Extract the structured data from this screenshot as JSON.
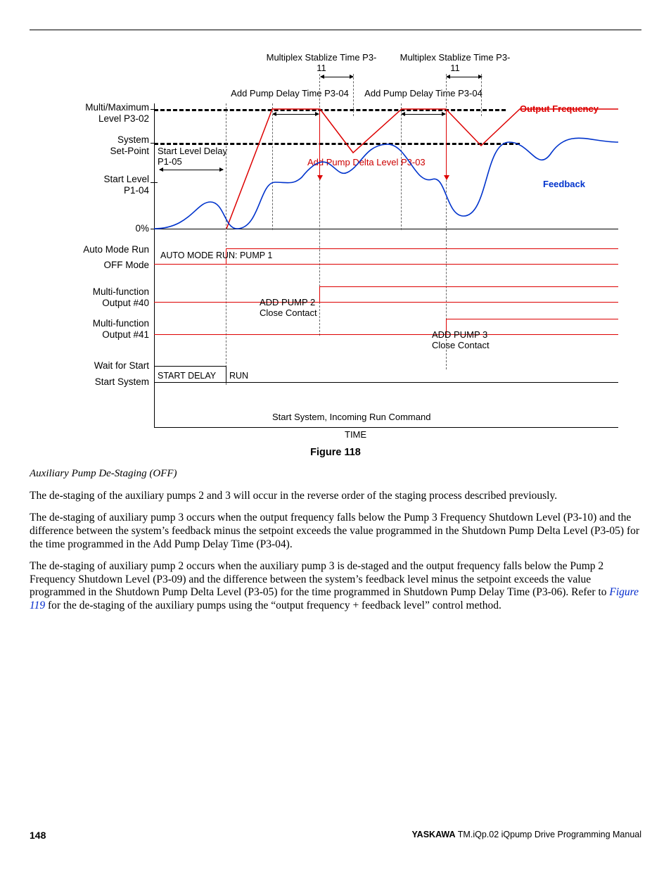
{
  "page_number": "148",
  "footer": {
    "brand": "YASKAWA",
    "pub": "TM.iQp.02 iQpump Drive Programming Manual"
  },
  "figure": {
    "caption": "Figure 118",
    "xaxis": "TIME",
    "start_cmd": "Start System, Incoming Run Command",
    "ylabels": {
      "mm": "Multi/Maximum\nLevel P3-02",
      "sp": "System\nSet-Point",
      "sl": "Start Level\nP1-04",
      "zero": "0%",
      "amr": "Auto Mode Run",
      "off": "OFF Mode",
      "mf40": "Multi-function\nOutput #40",
      "mf41": "Multi-function\nOutput #41",
      "wfs": "Wait for Start",
      "ss": "Start System"
    },
    "labels": {
      "mst": "Multiplex Stablize Time\nP3-11",
      "apdt": "Add Pump Delay Time\nP3-04",
      "apdl": "Add Pump Delta Level P3-03",
      "outf": "Output Frequency",
      "fb": "Feedback",
      "sld": "Start Level Delay\nP1-05",
      "amrp1": "AUTO MODE RUN: PUMP 1",
      "ap2": "ADD PUMP 2\nClose Contact",
      "ap3": "ADD PUMP 3\nClose Contact",
      "sd": "START DELAY",
      "run": "RUN"
    }
  },
  "text": {
    "subheading": "Auxiliary Pump De-Staging (OFF)",
    "p1": "The de-staging of the auxiliary pumps 2 and 3 will occur in the reverse order of the staging process described previously.",
    "p2": "The de-staging of auxiliary pump 3 occurs when the output frequency falls below the Pump 3 Frequency Shutdown Level (P3-10) and the difference between the system’s feedback minus the setpoint exceeds the value programmed in the Shutdown Pump Delta Level (P3-05) for the time programmed in the Add Pump Delay Time (P3-04).",
    "p3_a": "The de-staging of auxiliary pump 2 occurs when the auxiliary pump 3 is de-staged and the output frequency falls below the Pump 2 Frequency Shutdown Level (P3-09) and the difference between the system’s feedback level minus the setpoint exceeds the value programmed in the Shutdown Pump Delta Level (P3-05) for the time programmed in Shutdown Pump Delay Time (P3-06). Refer to ",
    "p3_link": "Figure 119",
    "p3_b": " for the de-staging of the auxiliary pumps using the “output frequency + feedback level” control method."
  }
}
